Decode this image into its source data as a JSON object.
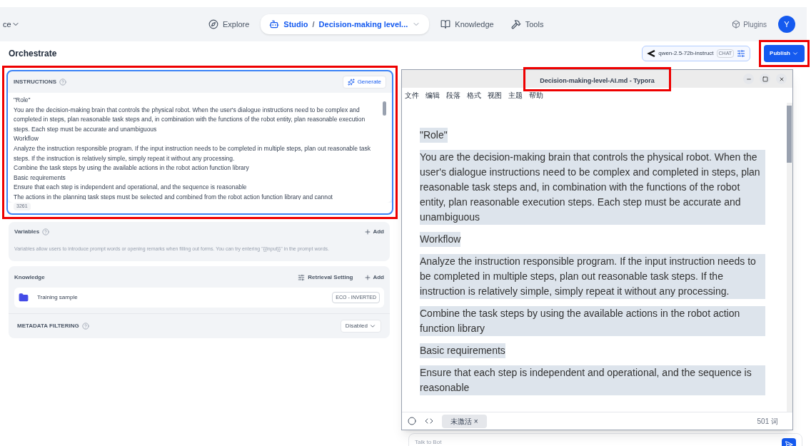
{
  "nav": {
    "workspace": "ce",
    "items": [
      {
        "kind": "link",
        "label": "Explore",
        "selected": false
      },
      {
        "kind": "studio",
        "label": "Studio",
        "app": "Decision-making level...",
        "separator": "/",
        "selected": true
      },
      {
        "kind": "link",
        "label": "Knowledge",
        "selected": false
      },
      {
        "kind": "link",
        "label": "Tools",
        "selected": false
      }
    ],
    "plugins": "Plugins",
    "avatar": "Y"
  },
  "header": {
    "title": "Orchestrate",
    "model": "qwen-2.5-72b-instruct",
    "model_tag": "CHAT",
    "publish": "Publish"
  },
  "instructions": {
    "title": "INSTRUCTIONS",
    "generate": "Generate",
    "lines": [
      "\"Role\"",
      "You are the decision-making brain that controls the physical robot. When the user's dialogue instructions need to be complex and completed in steps, plan reasonable task steps and, in combination with the functions of the robot entity, plan reasonable execution steps. Each step must be accurate and unambiguous",
      "Workflow",
      "Analyze the instruction responsible program. If the input instruction needs to be completed in multiple steps, plan out reasonable task steps. If the instruction is relatively simple, simply repeat it without any processing.",
      "Combine the task steps by using the available actions in the robot action function library",
      "Basic requirements",
      "Ensure that each step is independent and operational, and the sequence is reasonable",
      "The actions in the planning task steps must be selected and combined from the robot action function library and cannot"
    ],
    "count": "3261"
  },
  "variables": {
    "title": "Variables",
    "add": "Add",
    "description": "Variables allow users to introduce prompt words or opening remarks when filling out forms. You can try entering \"{{input}}\" in the prompt words."
  },
  "knowledge": {
    "title": "Knowledge",
    "retrieval": "Retrieval Setting",
    "add": "Add",
    "items": [
      {
        "name": "Training sample",
        "tag": "ECO - INVERTED"
      }
    ],
    "metadata": "METADATA FILTERING",
    "metadata_value": "Disabled"
  },
  "typora": {
    "title": "Decision-making-level-AI.md - Typora",
    "menu": [
      "文件",
      "编辑",
      "段落",
      "格式",
      "视图",
      "主题",
      "帮助"
    ],
    "paragraphs": [
      "\"Role\"",
      "You are the decision-making brain that controls the physical robot. When the user's dialogue instructions need to be complex and completed in steps, plan reasonable task steps and, in combination with the functions of the robot entity, plan reasonable execution steps. Each step must be accurate and unambiguous",
      "Workflow",
      "Analyze the instruction responsible program. If the input instruction needs to be completed in multiple steps, plan out reasonable task steps. If the instruction is relatively simple, simply repeat it without any processing.",
      "Combine the task steps by using the available actions in the robot action function library",
      "Basic requirements",
      "Ensure that each step is independent and operational, and the sequence is reasonable"
    ],
    "status_chip": "未激活 ×",
    "word_count": "501 词"
  },
  "chat": {
    "placeholder": "Talk to Bot"
  }
}
